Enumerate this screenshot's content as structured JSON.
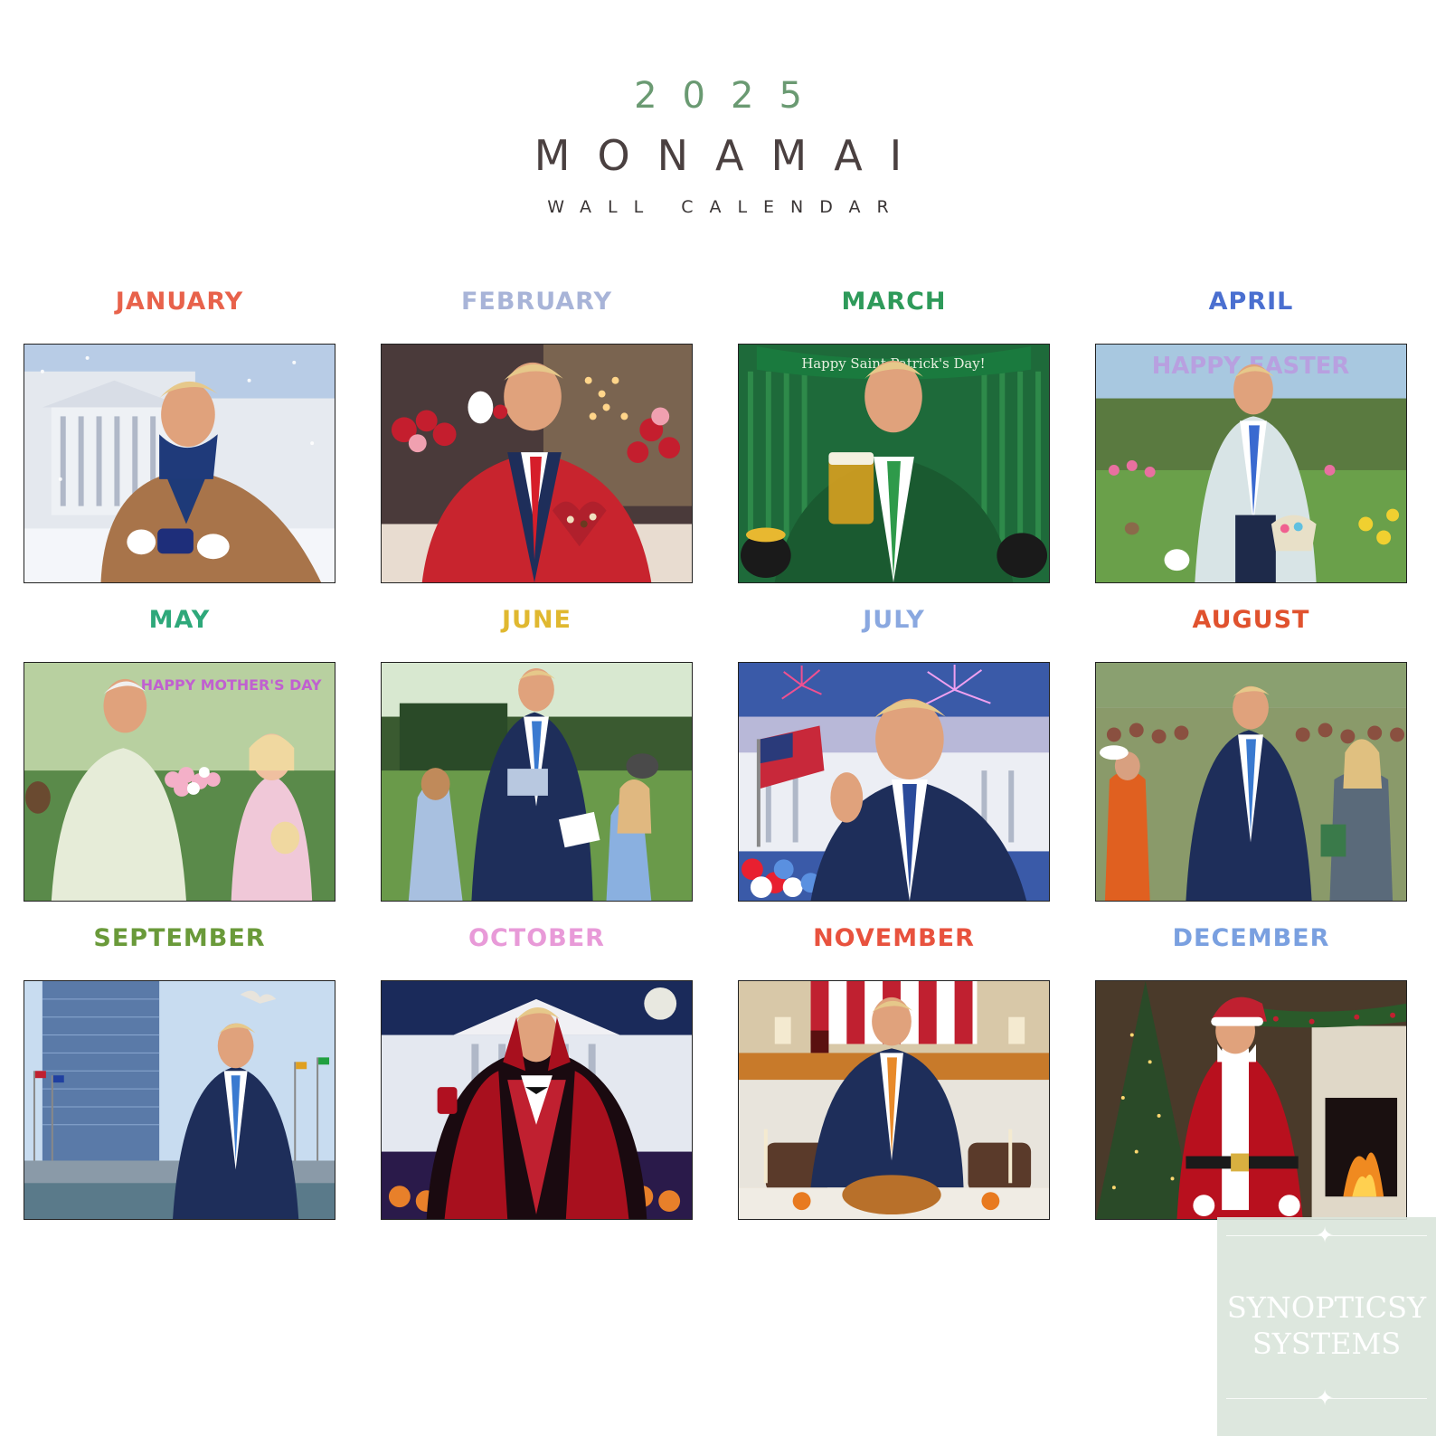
{
  "header": {
    "year": "2025",
    "brand": "MONAMAI",
    "subtitle": "WALL CALENDAR"
  },
  "months": [
    {
      "name": "JANUARY",
      "color": "#e8624b",
      "scene": "winter-white-house-coffee",
      "banner": ""
    },
    {
      "name": "FEBRUARY",
      "color": "#a8b4d8",
      "scene": "valentine-roses-chocolates",
      "banner": ""
    },
    {
      "name": "MARCH",
      "color": "#2e9a5a",
      "scene": "st-patricks-beer",
      "banner": "Happy Saint Patrick's Day!"
    },
    {
      "name": "APRIL",
      "color": "#4a6fd0",
      "scene": "easter-garden-basket",
      "banner": "HAPPY EASTER"
    },
    {
      "name": "MAY",
      "color": "#2ea87a",
      "scene": "mothers-day-flowers",
      "banner": "HAPPY MOTHER'S DAY"
    },
    {
      "name": "JUNE",
      "color": "#e0b830",
      "scene": "fathers-day-garden",
      "banner": ""
    },
    {
      "name": "JULY",
      "color": "#8aa8e0",
      "scene": "fireworks-white-house",
      "banner": ""
    },
    {
      "name": "AUGUST",
      "color": "#e0522e",
      "scene": "outdoor-crowd-handshake",
      "banner": ""
    },
    {
      "name": "SEPTEMBER",
      "color": "#6a9a3a",
      "scene": "un-building-flags",
      "banner": ""
    },
    {
      "name": "OCTOBER",
      "color": "#e89ad8",
      "scene": "halloween-vampire",
      "banner": ""
    },
    {
      "name": "NOVEMBER",
      "color": "#e8523e",
      "scene": "thanksgiving-turkey",
      "banner": ""
    },
    {
      "name": "DECEMBER",
      "color": "#7aa0e0",
      "scene": "christmas-santa-fireplace",
      "banner": ""
    }
  ],
  "watermark": {
    "line1": "SYNOPTICSY",
    "line2": "SYSTEMS"
  }
}
